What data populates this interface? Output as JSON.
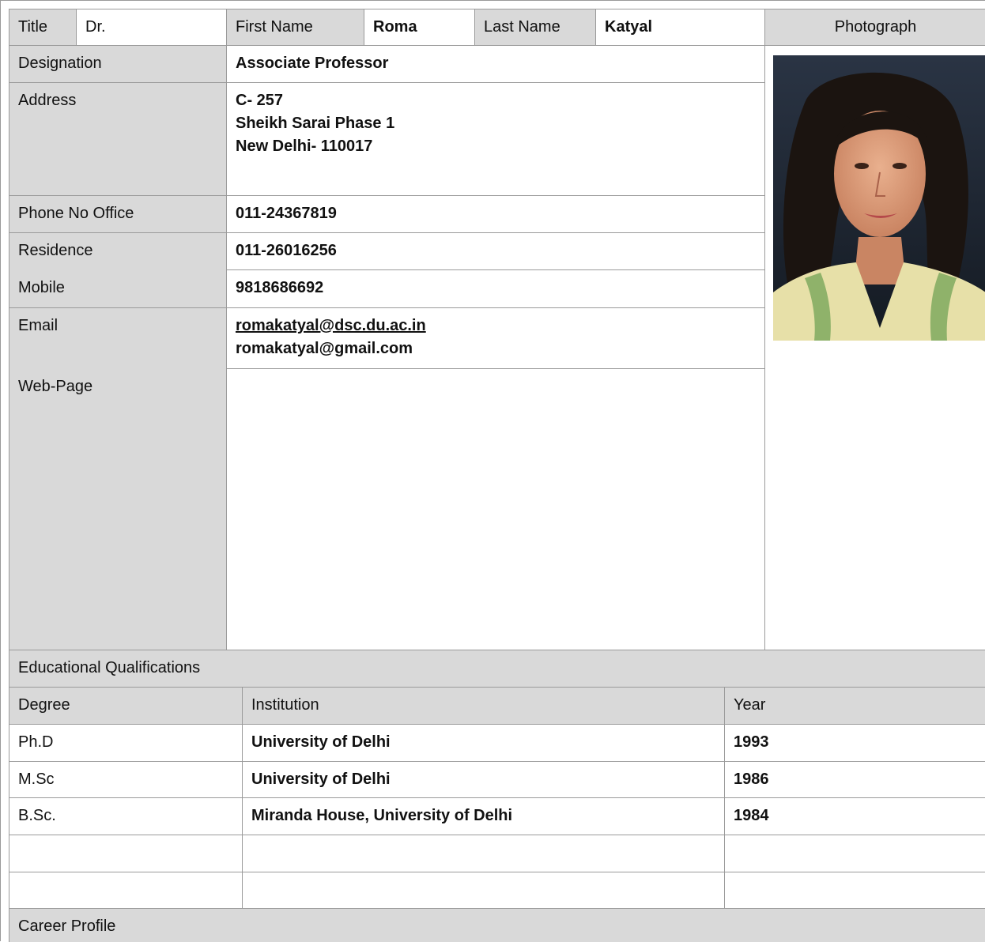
{
  "header": {
    "title_label": "Title",
    "title_value": "Dr.",
    "first_name_label": "First Name",
    "first_name_value": "Roma",
    "last_name_label": "Last Name",
    "last_name_value": "Katyal",
    "photograph_label": "Photograph"
  },
  "profile": {
    "designation_label": "Designation",
    "designation_value": "Associate Professor",
    "address_label": "Address",
    "address_value": "C- 257\nSheikh Sarai  Phase 1\nNew Delhi- 110017",
    "phone_label": "Phone No    Office",
    "phone_office_value": "011-24367819",
    "residence_label": "Residence",
    "residence_value": "011-26016256",
    "mobile_label": "Mobile",
    "mobile_value": "9818686692",
    "email_label": "Email",
    "email_primary": "romakatyal@dsc.du.ac.in",
    "email_secondary": "romakatyal@gmail.com",
    "webpage_label": "Web-Page"
  },
  "education": {
    "section_label": "Educational Qualifications",
    "headers": {
      "degree": "Degree",
      "institution": "Institution",
      "year": "Year"
    },
    "rows": [
      {
        "degree": "Ph.D",
        "institution": "University of Delhi",
        "year": "1993"
      },
      {
        "degree": "M.Sc",
        "institution": "University of Delhi",
        "year": "1986"
      },
      {
        "degree": "B.Sc.",
        "institution": "Miranda House, University of Delhi",
        "year": "1984"
      },
      {
        "degree": "",
        "institution": "",
        "year": ""
      },
      {
        "degree": "",
        "institution": "",
        "year": ""
      }
    ]
  },
  "career": {
    "section_label": "Career Profile"
  }
}
